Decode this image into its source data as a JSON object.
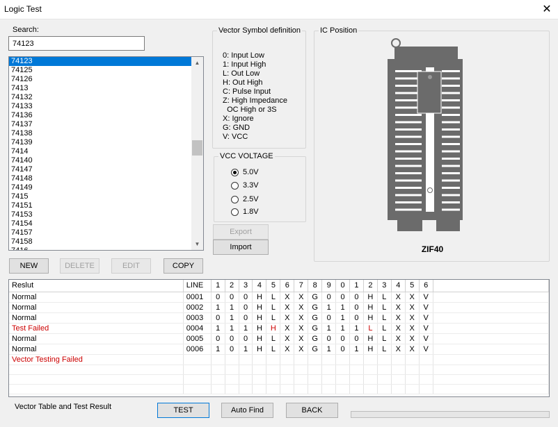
{
  "window": {
    "title": "Logic Test",
    "close_glyph": "✕"
  },
  "search": {
    "label": "Search:",
    "value": "74123"
  },
  "chip_list": {
    "selected": "74123",
    "items": [
      "74123",
      "74125",
      "74126",
      "7413",
      "74132",
      "74133",
      "74136",
      "74137",
      "74138",
      "74139",
      "7414",
      "74140",
      "74147",
      "74148",
      "74149",
      "7415",
      "74151",
      "74153",
      "74154",
      "74157",
      "74158",
      "7416"
    ]
  },
  "list_buttons": {
    "new": "NEW",
    "delete": "DELETE",
    "edit": "EDIT",
    "copy": "COPY"
  },
  "vector_def": {
    "title": "Vector Symbol definition",
    "lines": [
      "0: Input Low",
      "1: Input High",
      "L: Out Low",
      "H: Out High",
      "C: Pulse Input",
      "Z: High Impedance",
      "  OC High or 3S",
      "X: Ignore",
      "G: GND",
      "V: VCC"
    ]
  },
  "vcc": {
    "title": "VCC VOLTAGE",
    "options": [
      "5.0V",
      "3.3V",
      "2.5V",
      "1.8V"
    ],
    "selected": "5.0V"
  },
  "side_buttons": {
    "export": "Export",
    "import": "Import"
  },
  "ic_position": {
    "title": "IC Position",
    "socket": "ZIF40"
  },
  "results": {
    "headers": [
      "Reslut",
      "LINE",
      "1",
      "2",
      "3",
      "4",
      "5",
      "6",
      "7",
      "8",
      "9",
      "0",
      "1",
      "2",
      "3",
      "4",
      "5",
      "6"
    ],
    "rows": [
      {
        "status": "Normal",
        "failed": false,
        "line": "0001",
        "cells": [
          "0",
          "0",
          "0",
          "H",
          "L",
          "X",
          "X",
          "G",
          "0",
          "0",
          "0",
          "H",
          "L",
          "X",
          "X",
          "V"
        ]
      },
      {
        "status": "Normal",
        "failed": false,
        "line": "0002",
        "cells": [
          "1",
          "1",
          "0",
          "H",
          "L",
          "X",
          "X",
          "G",
          "1",
          "1",
          "0",
          "H",
          "L",
          "X",
          "X",
          "V"
        ]
      },
      {
        "status": "Normal",
        "failed": false,
        "line": "0003",
        "cells": [
          "0",
          "1",
          "0",
          "H",
          "L",
          "X",
          "X",
          "G",
          "0",
          "1",
          "0",
          "H",
          "L",
          "X",
          "X",
          "V"
        ]
      },
      {
        "status": "Test Failed",
        "failed": true,
        "line": "0004",
        "cells": [
          "1",
          "1",
          "1",
          "H",
          "H",
          "X",
          "X",
          "G",
          "1",
          "1",
          "1",
          "L",
          "L",
          "X",
          "X",
          "V"
        ],
        "failed_cells": [
          4,
          11
        ]
      },
      {
        "status": "Normal",
        "failed": false,
        "line": "0005",
        "cells": [
          "0",
          "0",
          "0",
          "H",
          "L",
          "X",
          "X",
          "G",
          "0",
          "0",
          "0",
          "H",
          "L",
          "X",
          "X",
          "V"
        ]
      },
      {
        "status": "Normal",
        "failed": false,
        "line": "0006",
        "cells": [
          "1",
          "0",
          "1",
          "H",
          "L",
          "X",
          "X",
          "G",
          "1",
          "0",
          "1",
          "H",
          "L",
          "X",
          "X",
          "V"
        ]
      },
      {
        "status": "Vector Testing Failed",
        "failed": true,
        "line": "",
        "cells": []
      }
    ]
  },
  "footer": {
    "label": "Vector Table and Test Result",
    "test": "TEST",
    "auto_find": "Auto Find",
    "back": "BACK"
  },
  "colors": {
    "selection": "#0078d7",
    "fail": "#cc0000",
    "socket": "#666666"
  }
}
